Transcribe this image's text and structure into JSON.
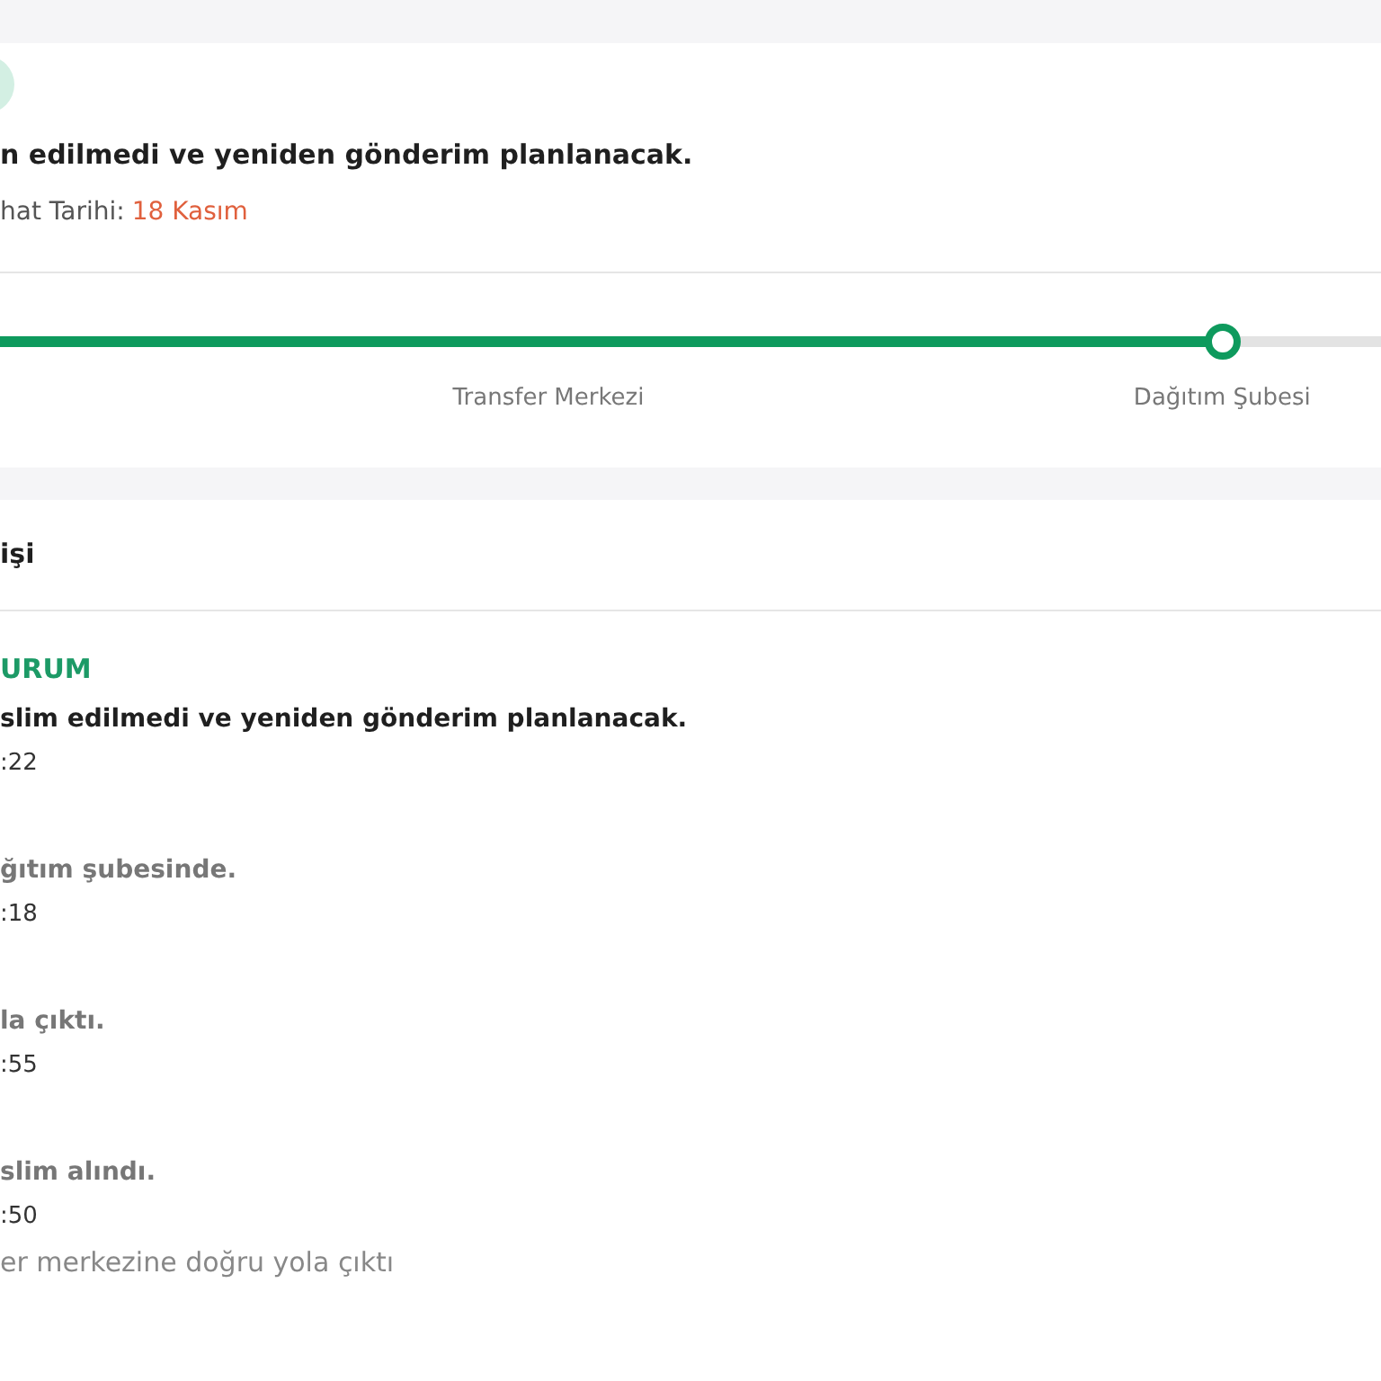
{
  "summary": {
    "message": "n edilmedi ve yeniden gönderim planlanacak.",
    "date_label": "hat Tarihi:",
    "date_value": "18 Kasım"
  },
  "progress": {
    "level": 0.885,
    "stops": [
      "Transfer Merkezi",
      "Dağıtım Şubesi"
    ]
  },
  "history": {
    "title": "işi",
    "events": [
      {
        "current": true,
        "status_label": "URUM",
        "text": "slim edilmedi ve yeniden gönderim planlanacak.",
        "time": ":22"
      },
      {
        "current": false,
        "text": "ğıtım şubesinde.",
        "time": ":18"
      },
      {
        "current": false,
        "text": "la çıktı.",
        "time": ":55"
      },
      {
        "current": false,
        "text": "slim alındı.",
        "time": ":50",
        "note": "er merkezine doğru yola çıktı"
      }
    ]
  }
}
